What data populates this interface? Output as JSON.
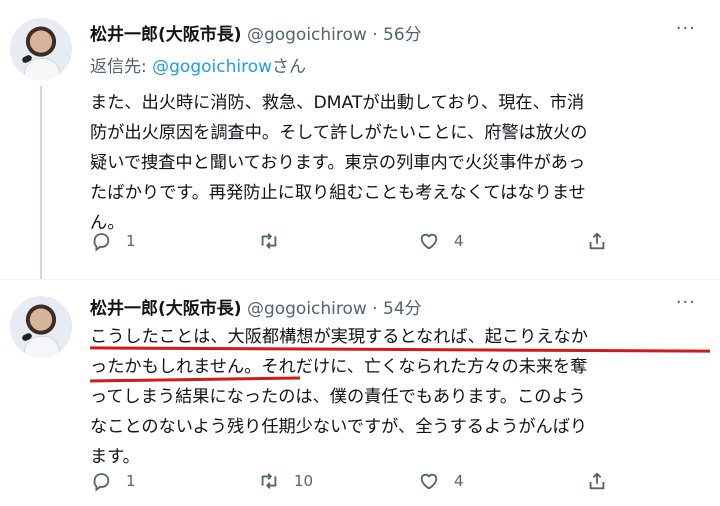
{
  "tweets": [
    {
      "name": "松井一郎(大阪市長)",
      "handle": "@gogoichirow",
      "separator": "·",
      "time": "56分",
      "more": "···",
      "reply_label": "返信先: ",
      "reply_handle": "@gogoichirow",
      "reply_suffix": "さん",
      "text": "また、出火時に消防、救急、DMATが出動しており、現在、市消\n防が出火原因を調査中。そして許しがたいことに、府警は放火の\n疑いで捜査中と聞いております。東京の列車内で火災事件があっ\nたばかりです。再発防止に取り組むことも考えなくてはなりませ\nん。",
      "reply_count": "1",
      "retweet_count": "",
      "like_count": "4"
    },
    {
      "name": "松井一郎(大阪市長)",
      "handle": "@gogoichirow",
      "separator": "·",
      "time": "54分",
      "more": "···",
      "text": "こうしたことは、大阪都構想が実現するとなれば、起こりえなか\nったかもしれません。それだけに、亡くなられた方々の未来を奪\nってしまう結果になったのは、僕の責任でもあります。このよう\nなことのないよう残り任期少ないですが、全うするようがんばり\nます。",
      "reply_count": "1",
      "retweet_count": "10",
      "like_count": "4"
    }
  ],
  "colors": {
    "accent": "#1d9bf0",
    "muted": "#536471",
    "underline": "#d11a1a"
  },
  "icons": [
    "reply-icon",
    "retweet-icon",
    "like-icon",
    "share-icon",
    "more-icon"
  ]
}
